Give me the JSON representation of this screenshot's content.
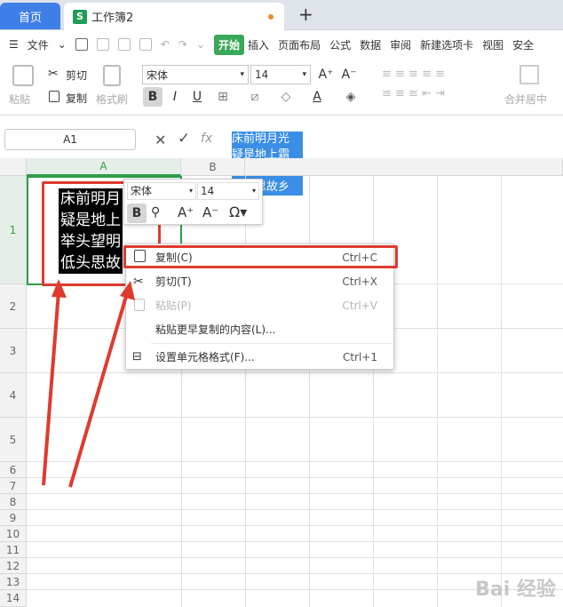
{
  "tabs": {
    "home": "首页",
    "doc": "工作簿2",
    "doc_icon": "S",
    "new_tab": "+"
  },
  "menu": {
    "file": "文件",
    "items": [
      "开始",
      "插入",
      "页面布局",
      "公式",
      "数据",
      "审阅",
      "新建选项卡",
      "视图",
      "安全"
    ]
  },
  "ribbon": {
    "paste": "粘贴",
    "cut": "剪切",
    "copy": "复制",
    "format_painter": "格式刷",
    "font_name": "宋体",
    "font_size": "14",
    "merge": "合并居中"
  },
  "formula_bar": {
    "name_box": "A1",
    "fx": "fx",
    "content": [
      "床前明月光",
      "疑是地上霜",
      "举头望明月",
      "低头思故乡"
    ]
  },
  "grid": {
    "columns": [
      "A",
      "B"
    ],
    "rows": [
      "1",
      "2",
      "3",
      "4",
      "5",
      "6",
      "7",
      "8",
      "9",
      "10",
      "11",
      "12",
      "13",
      "14"
    ],
    "a1_lines": [
      "床前明月",
      "疑是地上",
      "举头望明",
      "低头思故"
    ]
  },
  "mini_toolbar": {
    "font": "宋体",
    "size": "14",
    "bold": "B"
  },
  "context_menu": [
    {
      "label": "复制(C)",
      "shortcut": "Ctrl+C",
      "enabled": true
    },
    {
      "label": "剪切(T)",
      "shortcut": "Ctrl+X",
      "enabled": true
    },
    {
      "label": "粘贴(P)",
      "shortcut": "Ctrl+V",
      "enabled": false
    },
    {
      "label": "粘贴更早复制的内容(L)...",
      "shortcut": "",
      "enabled": true
    },
    {
      "label": "设置单元格格式(F)...",
      "shortcut": "Ctrl+1",
      "enabled": true
    }
  ],
  "watermark": "Bai 经验",
  "colors": {
    "accent": "#3f7fe8",
    "start": "#3aa85a",
    "annotation_red": "#e03a2f",
    "selection_green": "#2e9d4a"
  }
}
